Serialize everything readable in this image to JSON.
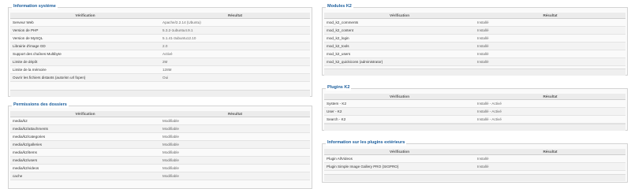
{
  "sysinfo": {
    "title": "Information système",
    "col1": "Vérification",
    "col2": "Résultat",
    "rows": [
      {
        "label": "Serveur Web",
        "value": "Apache/2.2.14 (Ubuntu)"
      },
      {
        "label": "Version de PHP",
        "value": "5.3.2-1ubuntu4.9.1"
      },
      {
        "label": "Version de MySQL",
        "value": "5.1.41-3ubuntu12.10"
      },
      {
        "label": "Librairie d'image GD",
        "value": "2.0"
      },
      {
        "label": "Support des chaînes Multibyte",
        "value": "Activé"
      },
      {
        "label": "Limite de dépôt",
        "value": "2M"
      },
      {
        "label": "Limite de la mémoire",
        "value": "128M"
      },
      {
        "label": "Ouvrir les fichiers distants (autorisn url fopen)",
        "value": "Oui"
      }
    ]
  },
  "perms": {
    "title": "Permissions des dossiers",
    "col1": "Vérification",
    "col2": "Résultat",
    "rows": [
      {
        "label": "media/k2",
        "value": "Modifiable"
      },
      {
        "label": "media/k2/attachments",
        "value": "Modifiable"
      },
      {
        "label": "media/k2/categories",
        "value": "Modifiable"
      },
      {
        "label": "media/k2/galleries",
        "value": "Modifiable"
      },
      {
        "label": "media/k2/items",
        "value": "Modifiable"
      },
      {
        "label": "media/k2/users",
        "value": "Modifiable"
      },
      {
        "label": "media/k2/videos",
        "value": "Modifiable"
      },
      {
        "label": "cache",
        "value": "Modifiable"
      }
    ]
  },
  "modules": {
    "title": "Modules K2",
    "col1": "Vérification",
    "col2": "Résultat",
    "rows": [
      {
        "label": "mod_k2_comments",
        "value": "Installé"
      },
      {
        "label": "mod_k2_content",
        "value": "Installé"
      },
      {
        "label": "mod_k2_login",
        "value": "Installé"
      },
      {
        "label": "mod_k2_tools",
        "value": "Installé"
      },
      {
        "label": "mod_k2_users",
        "value": "Installé"
      },
      {
        "label": "mod_k2_quickicons (administrator)",
        "value": "Installé"
      }
    ]
  },
  "plugins": {
    "title": "Plugins K2",
    "col1": "Vérification",
    "col2": "Résultat",
    "rows": [
      {
        "label": "System - K2",
        "value": "Installé - Activé"
      },
      {
        "label": "User - K2",
        "value": "Installé - Activé"
      },
      {
        "label": "Search - K2",
        "value": "Installé - Activé"
      }
    ]
  },
  "external": {
    "title": "Information sur les plugins extérieurs",
    "col1": "Vérification",
    "col2": "Résultat",
    "rows": [
      {
        "label": "Plugin AllVideos",
        "value": "Installé"
      },
      {
        "label": "Plugin Simple Image Gallery PRO (SIGPRO)",
        "value": "Installé"
      }
    ]
  }
}
